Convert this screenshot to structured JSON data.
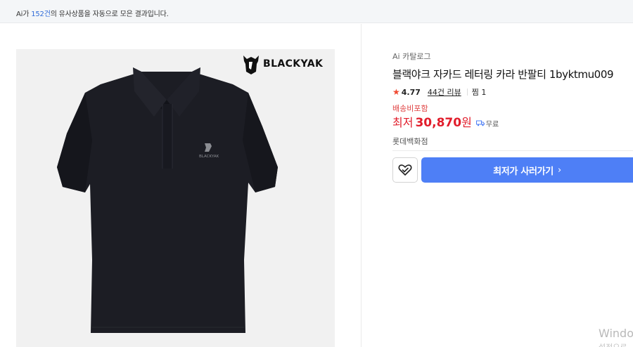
{
  "banner": {
    "prefix": "Ai가 ",
    "count": "152건",
    "suffix": "의 유사상품을 자동으로 모은 결과입니다."
  },
  "product": {
    "brand_logo_text": "BLACKYAK",
    "catalog_label": "Ai 카탈로그",
    "title": "블랙야크 자카드 레터링 카라 반팔티 1byktmu009",
    "rating": "4.77",
    "reviews": "44건 리뷰",
    "wishlist": "찜 1",
    "shipping_label": "배송비포함",
    "price_prefix": "최저",
    "price": "30,870",
    "price_unit": "원",
    "delivery": "무료",
    "store": "롯데백화점",
    "buy_label": "최저가 사러가기",
    "shirt_chest_logo_text": "BLACKYAK"
  },
  "watermark": {
    "line1": "Windo",
    "line2": "설정으로"
  },
  "icons": {
    "star": "star-icon",
    "truck": "truck-icon",
    "wish": "heart-check-icon",
    "chevron": "chevron-right-icon"
  },
  "colors": {
    "accent": "#4e7ff6",
    "price": "#e11d2b",
    "star": "#f04a32",
    "count_link": "#2f6bd8"
  }
}
